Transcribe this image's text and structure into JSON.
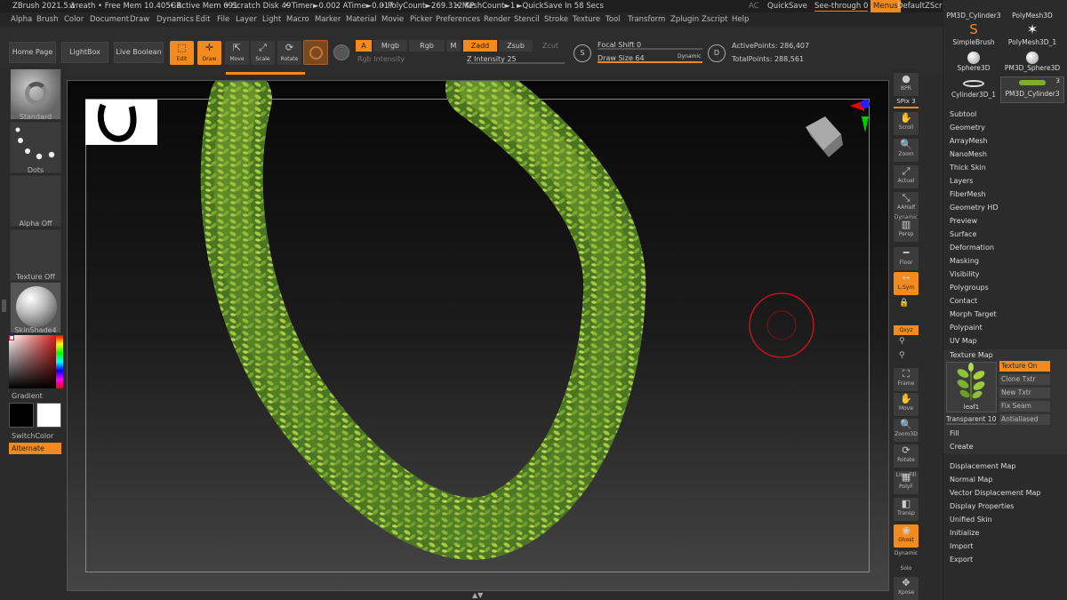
{
  "titlebar": {
    "app": "ZBrush 2021.5.1",
    "doc": "wreath",
    "free_mem": "• Free Mem 10.405GB",
    "active_mem": "• Active Mem 691",
    "scratch": "• Scratch Disk 49",
    "timer": "• Timer►0.002 ATime►0.017",
    "polycount": "• PolyCount►269.312 KP",
    "meshcount": "• MeshCount►1",
    "quicksave_in": "►QuickSave In 58 Secs",
    "ac": "AC",
    "quicksave": "QuickSave",
    "seethrough": "See-through",
    "seethrough_val": "0",
    "menus": "Menus",
    "defaultzscript": "DefaultZScript"
  },
  "menubar": [
    "Alpha",
    "Brush",
    "Color",
    "Document",
    "Draw",
    "Dynamics",
    "Edit",
    "File",
    "Layer",
    "Light",
    "Macro",
    "Marker",
    "Material",
    "Movie",
    "Picker",
    "Preferences",
    "Render",
    "Stencil",
    "Stroke",
    "Texture",
    "Tool",
    "Transform",
    "Zplugin",
    "Zscript",
    "Help"
  ],
  "toolbar": {
    "home": "Home Page",
    "lightbox": "LightBox",
    "liveboolean": "Live Boolean",
    "edit": "Edit",
    "draw": "Draw",
    "move": "Move",
    "scale": "Scale",
    "rotate": "Rotate",
    "a": "A",
    "mrgb": "Mrgb",
    "rgb": "Rgb",
    "m": "M",
    "zadd": "Zadd",
    "zsub": "Zsub",
    "zcut": "Zcut",
    "rgb_intensity": "Rgb Intensity",
    "z_intensity_label": "Z Intensity",
    "z_intensity": "25",
    "focal_label": "Focal Shift",
    "focal": "0",
    "drawsize_label": "Draw Size",
    "drawsize": "64",
    "dynamic": "Dynamic",
    "active_points": "ActivePoints: 286,407",
    "total_points": "TotalPoints: 288,561"
  },
  "left": {
    "standard": "Standard",
    "dots": "Dots",
    "alpha_off": "Alpha Off",
    "texture_off": "Texture Off",
    "skinshade": "SkinShade4",
    "gradient": "Gradient",
    "switchcolor": "SwitchColor",
    "alternate": "Alternate"
  },
  "shelf": {
    "bpr": "BPR",
    "spix_label": "SPix",
    "spix": "3",
    "scroll": "Scroll",
    "zoom": "Zoom",
    "actual": "Actual",
    "aahalf": "AAHalf",
    "dynamic": "Dynamic",
    "persp": "Persp",
    "floor": "Floor",
    "lsym": "L.Sym",
    "xyz": "Qxyz",
    "frame": "Frame",
    "move": "Move",
    "zoom3d": "Zoom3D",
    "rotate": "Rotate",
    "linefill": "Line Fill",
    "polyf": "PolyF",
    "transp": "Transp",
    "ghost": "Ghost",
    "dynamic2": "Dynamic",
    "solo": "Solo",
    "xpose": "Xpose"
  },
  "tools": {
    "pm3d_cyl": "PM3D_Cylinder3",
    "polymesh3d": "PolyMesh3D",
    "simplebrush": "SimpleBrush",
    "polymesh3d_1": "PolyMesh3D_1",
    "sphere3d": "Sphere3D",
    "pm3d_sphere": "PM3D_Sphere3D",
    "cyl3d_1": "Cylinder3D_1",
    "pm3d_cyl3": "PM3D_Cylinder3",
    "count": "3"
  },
  "subpalettes": [
    "Subtool",
    "Geometry",
    "ArrayMesh",
    "NanoMesh",
    "Thick Skin",
    "Layers",
    "FiberMesh",
    "Geometry HD",
    "Preview",
    "Surface",
    "Deformation",
    "Masking",
    "Visibility",
    "Polygroups",
    "Contact",
    "Morph Target",
    "Polypaint",
    "UV Map"
  ],
  "texture_map": {
    "title": "Texture Map",
    "texture_on": "Texture On",
    "clone": "Clone Txtr",
    "new": "New Txtr",
    "fixseam": "Fix Seam",
    "antialiased": "Antialiased",
    "thumb_label": "leaf1",
    "transparent_label": "Transparent",
    "transparent": "10",
    "fill": "Fill",
    "create": "Create"
  },
  "subpalettes2": [
    "Displacement Map",
    "Normal Map",
    "Vector Displacement Map",
    "Display Properties",
    "Unified Skin",
    "Initialize",
    "Import",
    "Export"
  ],
  "colors": {
    "accent": "#f28a1e",
    "panel": "#2b2b2b",
    "leaf": "#7fae2e"
  }
}
